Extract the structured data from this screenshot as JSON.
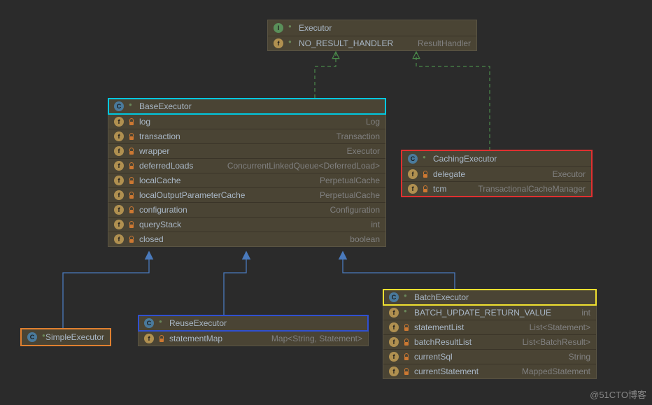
{
  "watermark": "@51CTO博客",
  "nodes": {
    "executor": {
      "title": "Executor",
      "members": [
        {
          "name": "NO_RESULT_HANDLER",
          "type": "ResultHandler",
          "icon": "f",
          "access": "open"
        }
      ]
    },
    "base": {
      "title": "BaseExecutor",
      "members": [
        {
          "name": "log",
          "type": "Log",
          "icon": "f",
          "access": "lock"
        },
        {
          "name": "transaction",
          "type": "Transaction",
          "icon": "f",
          "access": "lock"
        },
        {
          "name": "wrapper",
          "type": "Executor",
          "icon": "f",
          "access": "lock"
        },
        {
          "name": "deferredLoads",
          "type": "ConcurrentLinkedQueue<DeferredLoad>",
          "icon": "f",
          "access": "lock"
        },
        {
          "name": "localCache",
          "type": "PerpetualCache",
          "icon": "f",
          "access": "lock"
        },
        {
          "name": "localOutputParameterCache",
          "type": "PerpetualCache",
          "icon": "f",
          "access": "lock"
        },
        {
          "name": "configuration",
          "type": "Configuration",
          "icon": "f",
          "access": "lock"
        },
        {
          "name": "queryStack",
          "type": "int",
          "icon": "f",
          "access": "lock"
        },
        {
          "name": "closed",
          "type": "boolean",
          "icon": "f",
          "access": "lock"
        }
      ]
    },
    "caching": {
      "title": "CachingExecutor",
      "members": [
        {
          "name": "delegate",
          "type": "Executor",
          "icon": "f",
          "access": "lock"
        },
        {
          "name": "tcm",
          "type": "TransactionalCacheManager",
          "icon": "f",
          "access": "lock"
        }
      ]
    },
    "simple": {
      "title": "SimpleExecutor",
      "members": []
    },
    "reuse": {
      "title": "ReuseExecutor",
      "members": [
        {
          "name": "statementMap",
          "type": "Map<String, Statement>",
          "icon": "f",
          "access": "lock"
        }
      ]
    },
    "batch": {
      "title": "BatchExecutor",
      "members": [
        {
          "name": "BATCH_UPDATE_RETURN_VALUE",
          "type": "int",
          "icon": "f",
          "access": "open"
        },
        {
          "name": "statementList",
          "type": "List<Statement>",
          "icon": "f",
          "access": "lock"
        },
        {
          "name": "batchResultList",
          "type": "List<BatchResult>",
          "icon": "f",
          "access": "lock"
        },
        {
          "name": "currentSql",
          "type": "String",
          "icon": "f",
          "access": "lock"
        },
        {
          "name": "currentStatement",
          "type": "MappedStatement",
          "icon": "f",
          "access": "lock"
        }
      ]
    }
  },
  "chart_data": {
    "type": "uml-class-diagram",
    "interfaces": [
      "Executor"
    ],
    "classes": [
      "BaseExecutor",
      "CachingExecutor",
      "SimpleExecutor",
      "ReuseExecutor",
      "BatchExecutor"
    ],
    "relationships": [
      {
        "from": "BaseExecutor",
        "to": "Executor",
        "kind": "implements"
      },
      {
        "from": "CachingExecutor",
        "to": "Executor",
        "kind": "implements"
      },
      {
        "from": "SimpleExecutor",
        "to": "BaseExecutor",
        "kind": "extends"
      },
      {
        "from": "ReuseExecutor",
        "to": "BaseExecutor",
        "kind": "extends"
      },
      {
        "from": "BatchExecutor",
        "to": "BaseExecutor",
        "kind": "extends"
      }
    ],
    "highlights": {
      "BaseExecutor": "cyan",
      "CachingExecutor": "red",
      "SimpleExecutor": "orange",
      "ReuseExecutor": "blue",
      "BatchExecutor": "yellow"
    }
  }
}
